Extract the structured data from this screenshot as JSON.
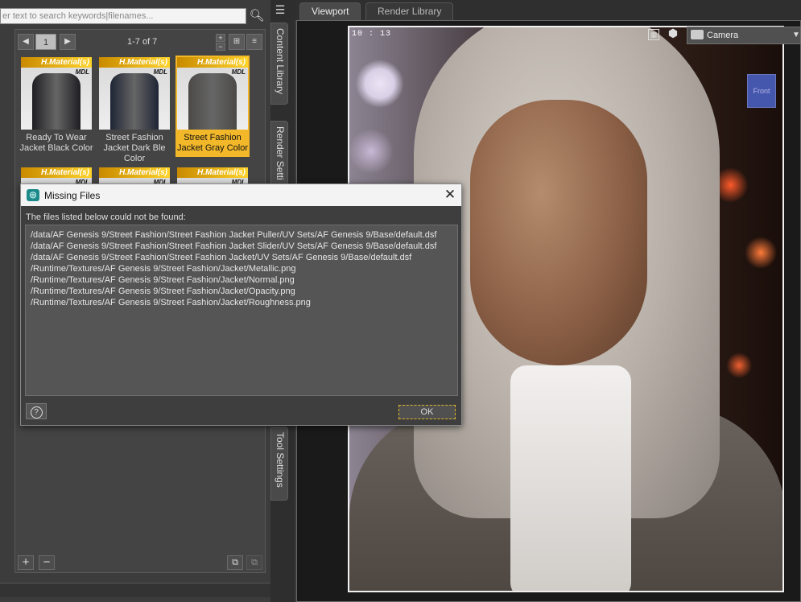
{
  "library": {
    "search_placeholder": "er text to search keywords|filenames...",
    "page": "1",
    "page_count": "1-7 of 7",
    "tiles": [
      {
        "badge": "H.Material(s)",
        "sub_badge": "MDL",
        "label": "Ready To Wear Jacket Black Color",
        "color": "#1e1e22",
        "selected": false
      },
      {
        "badge": "H.Material(s)",
        "sub_badge": "MDL",
        "label": "Street Fashion Jacket Dark Ble Color",
        "color": "#1f2535",
        "selected": false
      },
      {
        "badge": "H.Material(s)",
        "sub_badge": "MDL",
        "label": "Street Fashion Jacket Gray Color",
        "color": "#4c4a48",
        "selected": true
      },
      {
        "badge": "H.Material(s)",
        "sub_badge": "MDL",
        "label": "",
        "color": "#8a2a2a",
        "selected": false
      },
      {
        "badge": "H.Material(s)",
        "sub_badge": "MDL",
        "label": "",
        "color": "#8a4a2a",
        "selected": false
      },
      {
        "badge": "H.Material(s)",
        "sub_badge": "MDL",
        "label": "",
        "color": "#7a3a3a",
        "selected": false
      }
    ]
  },
  "side_tabs": {
    "content_library": "Content Library",
    "render_settings": "Render Setti",
    "tool_settings": "Tool Settings"
  },
  "viewport": {
    "tabs": [
      "Viewport",
      "Render Library"
    ],
    "timestamp": "10 : 13",
    "camera": "Camera",
    "nav_cube_label": "Front"
  },
  "dialog": {
    "title": "Missing Files",
    "message": "The files listed below could not be found:",
    "files": [
      "/data/AF Genesis 9/Street Fashion/Street Fashion Jacket Puller/UV Sets/AF Genesis 9/Base/default.dsf",
      "/data/AF Genesis 9/Street Fashion/Street Fashion Jacket Slider/UV Sets/AF Genesis 9/Base/default.dsf",
      "/data/AF Genesis 9/Street Fashion/Street Fashion Jacket/UV Sets/AF Genesis 9/Base/default.dsf",
      "/Runtime/Textures/AF Genesis 9/Street Fashion/Jacket/Metallic.png",
      "/Runtime/Textures/AF Genesis 9/Street Fashion/Jacket/Normal.png",
      "/Runtime/Textures/AF Genesis 9/Street Fashion/Jacket/Opacity.png",
      "/Runtime/Textures/AF Genesis 9/Street Fashion/Jacket/Roughness.png"
    ],
    "help_symbol": "?",
    "ok_label": "OK"
  },
  "colors": {
    "accent_selected": "#f2b82a",
    "badge": "#ffd42a",
    "dialog_bg": "#3e3e3e"
  }
}
